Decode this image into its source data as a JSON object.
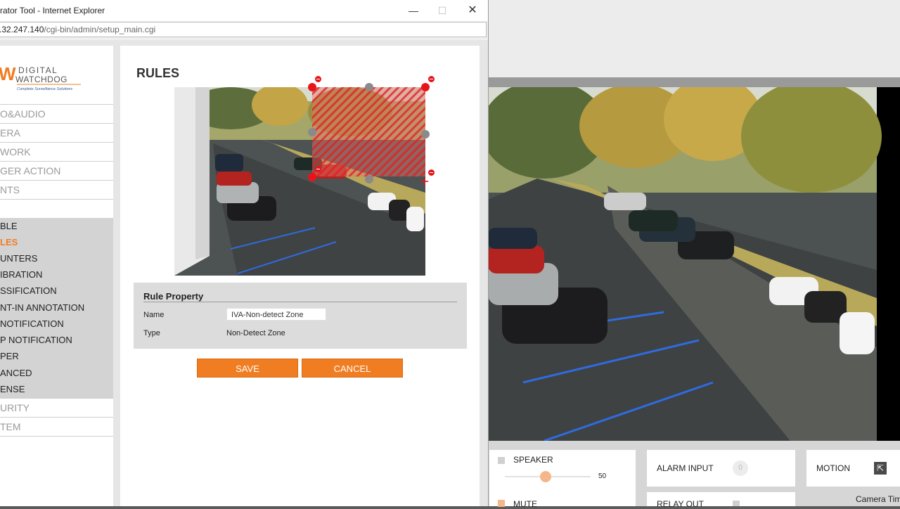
{
  "window": {
    "title": "rator Tool - Internet Explorer",
    "minimize_icon": "minimize-icon",
    "maximize_icon": "maximize-icon",
    "close_icon": "close-icon"
  },
  "address_bar": {
    "host": ".32.247.140",
    "path": "/cgi-bin/admin/setup_main.cgi"
  },
  "logo": {
    "brand_top": "DIGITAL",
    "brand_bottom": "WATCHDOG",
    "tagline": "Complete Surveillance Solutions",
    "mark": "W"
  },
  "sidebar": {
    "top_items": [
      {
        "label": "O&AUDIO"
      },
      {
        "label": "ERA"
      },
      {
        "label": "WORK"
      },
      {
        "label": "GER ACTION"
      },
      {
        "label": "NTS"
      }
    ],
    "sub_items": [
      {
        "label": "BLE"
      },
      {
        "label": "LES"
      },
      {
        "label": "UNTERS"
      },
      {
        "label": "IBRATION"
      },
      {
        "label": "SSIFICATION"
      },
      {
        "label": "NT-IN ANNOTATION"
      },
      {
        "label": " NOTIFICATION"
      },
      {
        "label": "P NOTIFICATION"
      },
      {
        "label": "PER"
      },
      {
        "label": "ANCED"
      },
      {
        "label": "ENSE"
      }
    ],
    "bottom_items": [
      {
        "label": "URITY"
      },
      {
        "label": "TEM"
      }
    ],
    "active_color": "#f07d22"
  },
  "main": {
    "page_title": "RULES",
    "rule_property": {
      "heading": "Rule Property",
      "name_label": "Name",
      "name_value": "IVA-Non-detect Zone",
      "type_label": "Type",
      "type_value": "Non-Detect Zone"
    },
    "save_label": "SAVE",
    "cancel_label": "CANCEL"
  },
  "right_panel": {
    "speaker_label": "SPEAKER",
    "speaker_volume": "50",
    "alarm_input_label": "ALARM INPUT",
    "alarm_input_count": "0",
    "motion_label": "MOTION",
    "mute_label": "MUTE",
    "relay_out_label": "RELAY OUT",
    "camera_time_label": "Camera Tim"
  },
  "colors": {
    "accent": "#f07d22",
    "zone_handle_red": "#e8141c",
    "zone_handle_grey": "#8a8a8a"
  }
}
